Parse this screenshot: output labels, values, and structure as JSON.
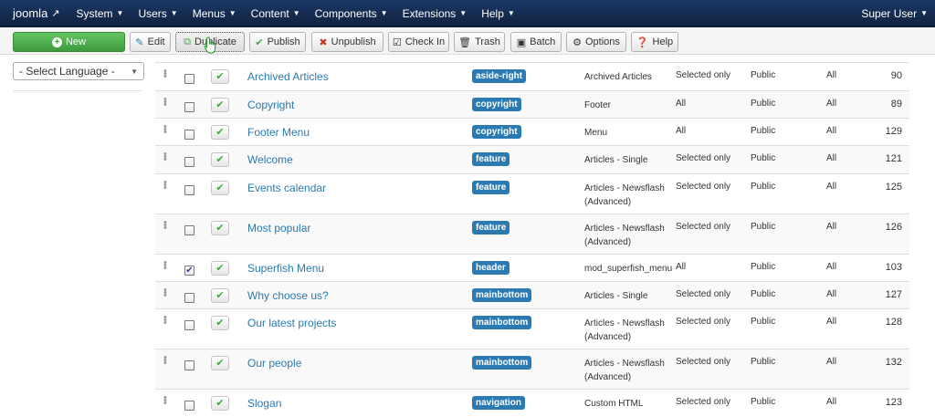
{
  "navbar": {
    "brand": "joomla",
    "menu": [
      "System",
      "Users",
      "Menus",
      "Content",
      "Components",
      "Extensions",
      "Help"
    ],
    "user": "Super User"
  },
  "toolbar": {
    "new": "New",
    "edit": "Edit",
    "duplicate": "Duplicate",
    "publish": "Publish",
    "unpublish": "Unpublish",
    "checkin": "Check In",
    "trash": "Trash",
    "batch": "Batch",
    "options": "Options",
    "help": "Help"
  },
  "sidebar": {
    "language_select": "- Select Language -"
  },
  "colors": {
    "navbar": "#142c51",
    "new_button": "#4da84d",
    "badge": "#2b7ab1",
    "link": "#2a7ab0",
    "published": "#46a546"
  },
  "rows": [
    {
      "title": "Archived Articles",
      "position": "aside-right",
      "type": "Archived Articles",
      "pages": "Selected only",
      "access": "Public",
      "language": "All",
      "id": "90",
      "checked": false,
      "height": 31
    },
    {
      "title": "Copyright",
      "position": "copyright",
      "type": "Footer",
      "pages": "All",
      "access": "Public",
      "language": "All",
      "id": "89",
      "checked": false,
      "height": 30
    },
    {
      "title": "Footer Menu",
      "position": "copyright",
      "type": "Menu",
      "pages": "All",
      "access": "Public",
      "language": "All",
      "id": "129",
      "checked": false,
      "height": 30
    },
    {
      "title": "Welcome",
      "position": "feature",
      "type": "Articles - Single",
      "pages": "Selected only",
      "access": "Public",
      "language": "All",
      "id": "121",
      "checked": false,
      "height": 31
    },
    {
      "title": "Events calendar",
      "position": "feature",
      "type": "Articles - Newsflash (Advanced)",
      "pages": "Selected only",
      "access": "Public",
      "language": "All",
      "id": "125",
      "checked": false,
      "height": 44
    },
    {
      "title": "Most popular",
      "position": "feature",
      "type": "Articles - Newsflash (Advanced)",
      "pages": "Selected only",
      "access": "Public",
      "language": "All",
      "id": "126",
      "checked": false,
      "height": 44
    },
    {
      "title": "Superfish Menu",
      "position": "header",
      "type": "mod_superfish_menu",
      "pages": "All",
      "access": "Public",
      "language": "All",
      "id": "103",
      "checked": true,
      "height": 30
    },
    {
      "title": "Why choose us?",
      "position": "mainbottom",
      "type": "Articles - Single",
      "pages": "Selected only",
      "access": "Public",
      "language": "All",
      "id": "127",
      "checked": false,
      "height": 30
    },
    {
      "title": "Our latest projects",
      "position": "mainbottom",
      "type": "Articles - Newsflash (Advanced)",
      "pages": "Selected only",
      "access": "Public",
      "language": "All",
      "id": "128",
      "checked": false,
      "height": 44
    },
    {
      "title": "Our people",
      "position": "mainbottom",
      "type": "Articles - Newsflash (Advanced)",
      "pages": "Selected only",
      "access": "Public",
      "language": "All",
      "id": "132",
      "checked": false,
      "height": 44
    },
    {
      "title": "Slogan",
      "position": "navigation",
      "type": "Custom HTML",
      "pages": "Selected only",
      "access": "Public",
      "language": "All",
      "id": "123",
      "checked": false,
      "height": 31
    }
  ]
}
